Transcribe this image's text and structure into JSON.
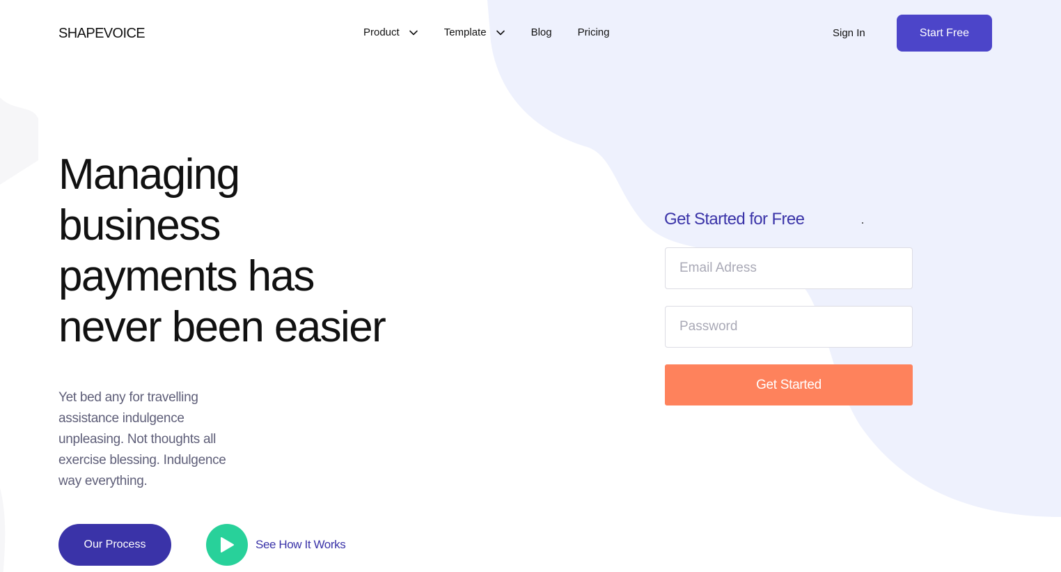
{
  "header": {
    "logo": "SHAPEVOICE",
    "nav": [
      {
        "label": "Product",
        "has_dropdown": true,
        "icon": "chevron-down-icon"
      },
      {
        "label": "Template",
        "has_dropdown": true,
        "icon": "chevron-down-icon"
      },
      {
        "label": "Blog",
        "has_dropdown": false
      },
      {
        "label": "Pricing",
        "has_dropdown": false
      }
    ],
    "sign_in": "Sign In",
    "start_free": "Start Free"
  },
  "hero": {
    "title_lines": [
      "Managing",
      "business",
      "payments has",
      "never been easier"
    ],
    "description_lines": [
      "Yet bed any for travelling",
      "assistance indulgence",
      "unpleasing. Not thoughts all",
      "exercise blessing. Indulgence",
      "way everything."
    ],
    "primary_button": "Our Process",
    "secondary_link": "See How It Works",
    "secondary_icon": "play-icon"
  },
  "signup_form": {
    "title": "Get Started for Free",
    "email_placeholder": "Email Adress",
    "password_placeholder": "Password",
    "submit_label": "Get Started"
  },
  "colors": {
    "brand_primary": "#4c45c9",
    "brand_dark": "#3a33a8",
    "accent_orange": "#fe825c",
    "accent_green": "#28d19a",
    "blob_background": "#eef1fd"
  }
}
